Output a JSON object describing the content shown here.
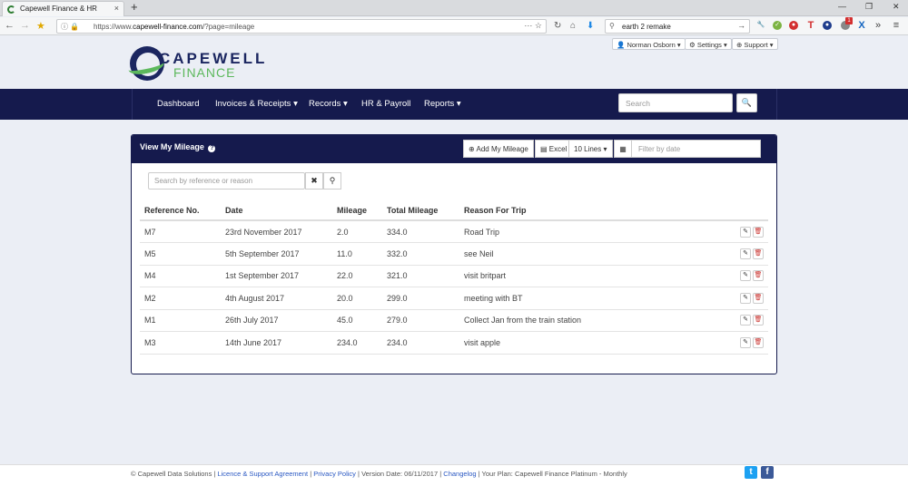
{
  "browser": {
    "tab_title": "Capewell Finance & HR",
    "tab_close": "×",
    "new_tab": "+",
    "url_prefix": "https://www.",
    "url_domain": "capewell-finance.com",
    "url_path": "/?page=mileage",
    "url_dots": "···",
    "search_text": "earth 2 remake",
    "search_go": "→",
    "more": "»",
    "badge_count": "1"
  },
  "header": {
    "logo_top": "CAPEWELL",
    "logo_bottom": "FINANCE",
    "user_menu": "Norman Osborn",
    "settings_menu": "Settings",
    "support_menu": "Support"
  },
  "nav": {
    "items": [
      "Dashboard",
      "Invoices & Receipts",
      "Records",
      "HR & Payroll",
      "Reports"
    ],
    "search_placeholder": "Search"
  },
  "panel": {
    "title": "View My Mileage",
    "add_button": "Add My Mileage",
    "excel_button": "Excel",
    "lines_button": "10 Lines",
    "filter_placeholder": "Filter by date",
    "ref_search_placeholder": "Search by reference or reason"
  },
  "table": {
    "headers": [
      "Reference No.",
      "Date",
      "Mileage",
      "Total Mileage",
      "Reason For Trip"
    ],
    "rows": [
      [
        "M7",
        "23rd November 2017",
        "2.0",
        "334.0",
        "Road Trip"
      ],
      [
        "M5",
        "5th September 2017",
        "11.0",
        "332.0",
        "see Neil"
      ],
      [
        "M4",
        "1st September 2017",
        "22.0",
        "321.0",
        "visit britpart"
      ],
      [
        "M2",
        "4th August 2017",
        "20.0",
        "299.0",
        "meeting with BT"
      ],
      [
        "M1",
        "26th July 2017",
        "45.0",
        "279.0",
        "Collect Jan from the train station"
      ],
      [
        "M3",
        "14th June 2017",
        "234.0",
        "234.0",
        "visit apple"
      ]
    ]
  },
  "footer": {
    "copyright": "© Capewell Data Solutions |",
    "licence": "Licence & Support Agreement",
    "sep1": "|",
    "privacy": "Privacy Policy",
    "version": "| Version Date: 06/11/2017 |",
    "changelog": "Changelog",
    "plan": "| Your Plan: Capewell Finance Platinum - Monthly"
  },
  "colors": {
    "navy": "#151a4d",
    "green": "#5cb85c",
    "link": "#2b59c3",
    "danger": "#c9302c"
  }
}
